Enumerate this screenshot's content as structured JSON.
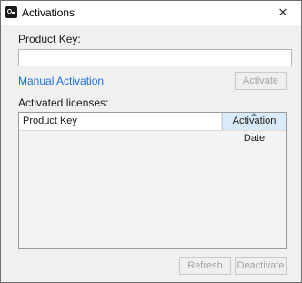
{
  "window": {
    "title": "Activations",
    "close_glyph": "✕"
  },
  "form": {
    "product_key_label": "Product Key:",
    "product_key_value": "",
    "manual_activation_link": "Manual Activation",
    "activate_button": "Activate",
    "activated_licenses_label": "Activated licenses:"
  },
  "licenses_table": {
    "columns": [
      "Product Key",
      "Activation Date"
    ],
    "rows": []
  },
  "footer": {
    "refresh_button": "Refresh",
    "deactivate_button": "Deactivate"
  },
  "icons": {
    "app": "app-logo-icon",
    "close": "close-icon",
    "sort": "sort-ascending-icon"
  },
  "colors": {
    "link": "#1f6fd6",
    "sorted_column_bg": "#d9ebf9",
    "disabled_text": "#a3a3a3"
  }
}
